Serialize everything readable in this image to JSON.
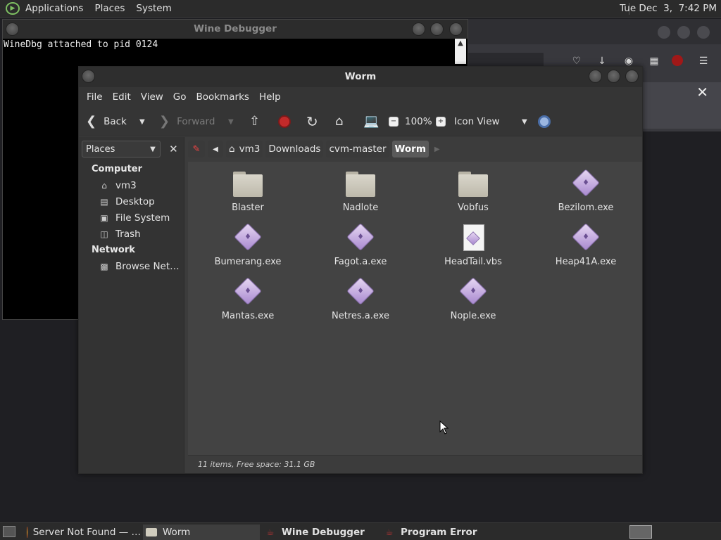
{
  "top_panel": {
    "menus": [
      "Applications",
      "Places",
      "System"
    ],
    "clock": "Tue Dec  3,  7:42 PM"
  },
  "wine": {
    "title": "Wine Debugger",
    "console_line": "WineDbg attached to pid 0124"
  },
  "nautilus": {
    "title": "Worm",
    "menu": [
      "File",
      "Edit",
      "View",
      "Go",
      "Bookmarks",
      "Help"
    ],
    "toolbar": {
      "back": "Back",
      "forward": "Forward",
      "zoom": "100%",
      "view_mode": "Icon View"
    },
    "sidebar": {
      "select_label": "Places",
      "computer_heading": "Computer",
      "network_heading": "Network",
      "items": [
        "vm3",
        "Desktop",
        "File System",
        "Trash"
      ],
      "network_items": [
        "Browse Net…"
      ]
    },
    "path": [
      "vm3",
      "Downloads",
      "cvm-master",
      "Worm"
    ],
    "files": [
      {
        "name": "Blaster",
        "kind": "folder"
      },
      {
        "name": "Nadlote",
        "kind": "folder"
      },
      {
        "name": "Vobfus",
        "kind": "folder"
      },
      {
        "name": "Bezilom.exe",
        "kind": "exe"
      },
      {
        "name": "Bumerang.exe",
        "kind": "exe"
      },
      {
        "name": "Fagot.a.exe",
        "kind": "exe"
      },
      {
        "name": "HeadTail.vbs",
        "kind": "vbs"
      },
      {
        "name": "Heap41A.exe",
        "kind": "exe"
      },
      {
        "name": "Mantas.exe",
        "kind": "exe"
      },
      {
        "name": "Netres.a.exe",
        "kind": "exe"
      },
      {
        "name": "Nople.exe",
        "kind": "exe"
      }
    ],
    "status": "11 items, Free space: 31.1 GB"
  },
  "taskbar": {
    "tasks": [
      "Server Not Found — …",
      "Worm",
      "Wine Debugger",
      "Program Error"
    ]
  }
}
